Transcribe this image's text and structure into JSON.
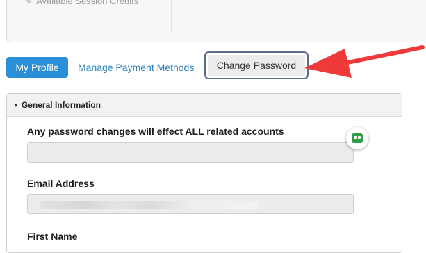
{
  "top": {
    "credits_label": "Available Session Credits"
  },
  "tabs": {
    "profile": "My Profile",
    "payment": "Manage Payment Methods",
    "password": "Change Password"
  },
  "panel": {
    "title": "General Information",
    "fields": [
      {
        "label": "Any password changes will effect ALL related accounts",
        "value": ""
      },
      {
        "label": "Email Address",
        "value": ""
      },
      {
        "label": "First Name",
        "value": ""
      }
    ]
  },
  "colors": {
    "primary_tab": "#2a8fd6",
    "link": "#2a80c0",
    "highlight_border": "#5e6c91",
    "arrow": "#f03a3a",
    "badge": "#2e9e4a"
  },
  "icons": {
    "credits": "pencil-icon",
    "section_toggle": "caret-down-icon",
    "password_manager": "password-manager-icon",
    "annotation": "red-arrow-icon"
  }
}
